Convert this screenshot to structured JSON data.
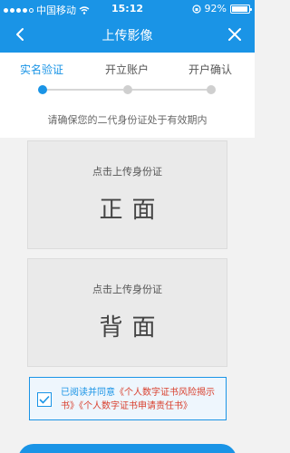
{
  "status_bar": {
    "carrier": "中国移动",
    "time": "15:12",
    "battery": "92%"
  },
  "nav": {
    "title": "上传影像"
  },
  "steps": [
    {
      "label": "实名验证",
      "active": true
    },
    {
      "label": "开立账户",
      "active": false
    },
    {
      "label": "开户确认",
      "active": false
    }
  ],
  "hint": "请确保您的二代身份证处于有效期内",
  "upload_front": {
    "caption": "点击上传身份证",
    "side": "正面"
  },
  "upload_back": {
    "caption": "点击上传身份证",
    "side": "背面"
  },
  "agreement": {
    "checked": true,
    "prefix": "已阅读并同意",
    "doc1": "《个人数字证书风险揭示书》",
    "doc2": "《个人数字证书申请责任书》"
  },
  "colors": {
    "brand": "#1a94e6",
    "link_red": "#d9412f"
  },
  "icons": {
    "back": "chevron-left-icon",
    "close": "close-icon",
    "wifi": "wifi-icon",
    "check": "check-icon"
  }
}
